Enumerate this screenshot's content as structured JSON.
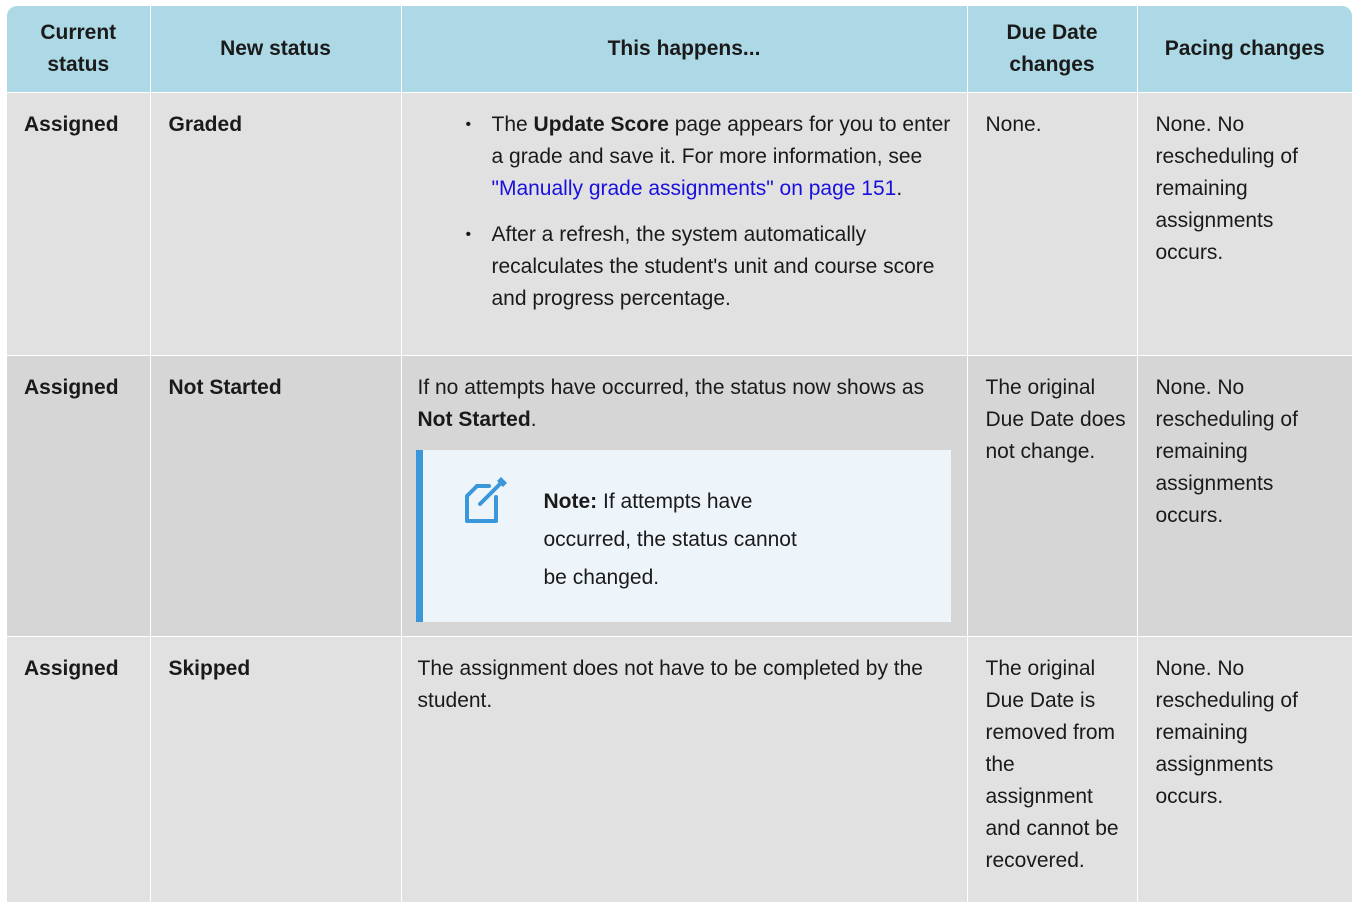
{
  "headers": [
    "Current status",
    "New status",
    "This happens...",
    "Due Date changes",
    "Pacing changes"
  ],
  "rows": [
    {
      "current": "Assigned",
      "new": "Graded",
      "bullet1": {
        "pre": "The ",
        "bold": "Update Score",
        "mid": " page appears for you to enter a grade and save it. For more information, see ",
        "link": "\"Manually grade assignments\" on page 151",
        "post": "."
      },
      "bullet2": "After a refresh, the system automatically recalculates the student's unit and course score and progress percentage.",
      "due": "None.",
      "pacing": "None. No rescheduling of remaining assignments occurs."
    },
    {
      "current": "Assigned",
      "new": "Not Started",
      "happens_pre": "If no attempts have occurred, the status now shows as ",
      "happens_bold": "Not Started",
      "happens_post": ".",
      "note_label": "Note:",
      "note_text": " If attempts have occurred, the status cannot be changed.",
      "due": "The original Due Date does not change.",
      "pacing": "None. No rescheduling of remaining assignments occurs."
    },
    {
      "current": "Assigned",
      "new": "Skipped",
      "happens": "The assignment does not have to be completed by the student.",
      "due": "The original Due Date is removed from the assignment and cannot be recovered.",
      "pacing": "None. No rescheduling of remaining assignments occurs."
    }
  ],
  "colors": {
    "header_bg": "#add8e6",
    "row_light": "#e1e1e1",
    "row_dark": "#d6d6d6",
    "link": "#1a10dd",
    "note_bg": "#eef5fa",
    "note_border": "#3a97d9"
  },
  "icons": {
    "note": "note-edit-icon"
  }
}
